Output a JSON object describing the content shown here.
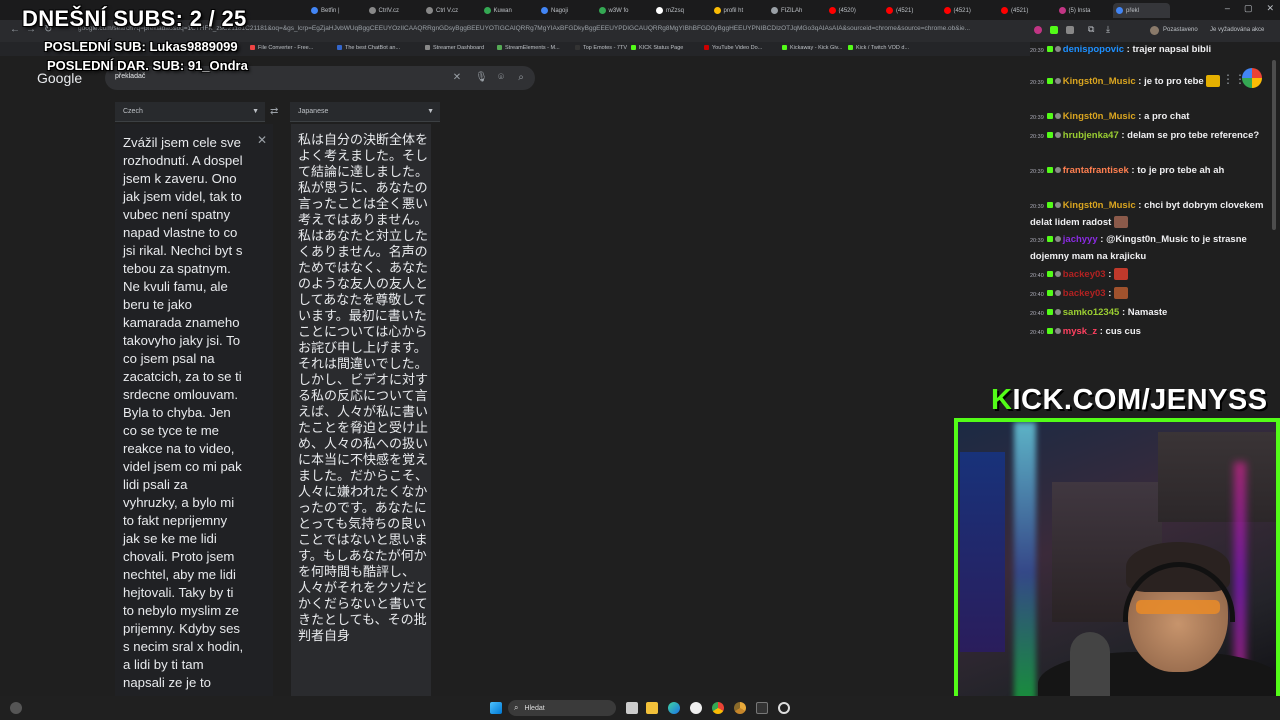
{
  "overlay": {
    "subs_count": "DNEŠNÍ SUBS: 2 / 25",
    "last_sub": "POSLEDNÍ SUB: Lukas9889099",
    "last_donation": "POSLEDNÍ DAR. SUB: 91_Ondra",
    "kick_banner_prefix": "K",
    "kick_banner_rest": "ICK.COM/JENYSS"
  },
  "browser": {
    "tabs": [
      {
        "label": "Betfin |",
        "color": "#4285f4"
      },
      {
        "label": "CtrlV.cz",
        "color": "#888888"
      },
      {
        "label": "Ctrl V.cz",
        "color": "#888888"
      },
      {
        "label": "Kuwan",
        "color": "#34a853"
      },
      {
        "label": "Nagoji",
        "color": "#4285f4"
      },
      {
        "label": "w3W fo",
        "color": "#34a853"
      },
      {
        "label": "mZzsq",
        "color": "#ffffff"
      },
      {
        "label": "profil ht",
        "color": "#fbbc05"
      },
      {
        "label": "FIZILAh",
        "color": "#9aa0a6"
      },
      {
        "label": "(4520) ",
        "color": "#ff0000"
      },
      {
        "label": "(4521) ",
        "color": "#ff0000"
      },
      {
        "label": "(4521) ",
        "color": "#ff0000"
      },
      {
        "label": "(4521) ",
        "color": "#ff0000"
      },
      {
        "label": "(5) Insta",
        "color": "#c13584"
      },
      {
        "label": "překl",
        "color": "#4285f4"
      }
    ],
    "url": "google.com/search?q=prekladac&oq=1CTHFK_zsC21181C21181&oq=&gs_lcrp=EgZjaHJvbWUqBggCEEUYOzIICAAQRRgnGDsyBggBEEUYOTIGCAIQRRg7MgYIAxBFGDkyBggEEEUYPDIGCAUQRRg8MgYIBhBFGD0yBggHEEUYPNIBCDIzOTJqMGo3qAIAsAIA&sourceid=chrome&source=chrome.ob&ie...",
    "profile_label": "Pozastaveno",
    "sync_label": "Je vyžadována akce",
    "bookmarks": [
      "File Converter - Free...",
      "The best ChatBot an...",
      "Streamer Dashboard",
      "StreamElements - M...",
      "Top Emotes - 7TV",
      "KICK Status Page",
      "YouTube Video Do...",
      "Kickaway - Kick Giv...",
      "Kick / Twitch VOD d..."
    ]
  },
  "google": {
    "logo": "Google",
    "query": "překladač",
    "clear_icon": "close-icon",
    "mic_icon": "mic-icon",
    "lens_icon": "lens-icon",
    "search_icon": "search-icon"
  },
  "translate": {
    "source_lang": "Czech",
    "target_lang": "Japanese",
    "source_text": "Zvážil jsem cele sve\nrozhodnutí. A dospel\njsem k zaveru. Ono\njak jsem videl, tak to\nvubec není spatny\nnapad vlastne to co\njsi rikal. Nechci byt s\ntebou za spatnym.\nNe kvuli famu, ale\nberu te jako\nkamarada znameho\ntakovyho jaky jsi. To\nco jsem psal na\nzacatcich, za to se ti\nsrdecne omlouvam.\nByla to chyba. Jen\nco se tyce te me\nreakce na to video,\nvidel jsem co mi pak\nlidi psali za\nvyhruzky, a bylo mi\nto fakt neprijemny\njak se ke me lidi\nchovali. Proto jsem\nnechtel, aby me lidi\nhejtovali. Taky by ti\nto nebylo myslim ze\nprijemny. Kdyby ses\ns necim sral x hodin,\na lidi by ti tam\nnapsali ze je to",
    "target_text": "私は自分の決断全体をよく考えました。そして結論に達しました。私が思うに、あなたの言ったことは全く悪い考えではありません。私はあなたと対立したくありません。名声のためではなく、あなたのような友人の友人としてあなたを尊敬しています。最初に書いたことについては心からお詫び申し上げます。それは間違いでした。しかし、ビデオに対する私の反応について言えば、人々が私に書いたことを脅迫と受け止め、人々の私への扱いに本当に不快感を覚えました。だからこそ、人々に嫌われたくなかったのです。あなたにとっても気持ちの良いことではないと思います。もしあなたが何かを何時間も酷評し、人々がそれをクソだとかくだらないと書いてきたとしても、その批判者自身"
  },
  "chat": {
    "messages": [
      {
        "time": "20:39",
        "user": "denispopovic",
        "user_color": "#1e90ff",
        "text": ": trajer napsal bibli",
        "emote": ""
      },
      {
        "time": "20:39",
        "user": "Kingst0n_Music",
        "user_color": "#daa520",
        "text": ": je to pro tebe",
        "emote": "#e5b000"
      },
      {
        "time": "20:39",
        "user": "Kingst0n_Music",
        "user_color": "#daa520",
        "text": ": a pro chat",
        "emote": ""
      },
      {
        "time": "20:39",
        "user": "hrubjenka47",
        "user_color": "#9acd32",
        "text": ": delam se pro tebe reference?",
        "emote": ""
      },
      {
        "time": "20:39",
        "user": "frantafrantisek",
        "user_color": "#ff7f50",
        "text": ": to je pro tebe ah ah",
        "emote": ""
      },
      {
        "time": "20:39",
        "user": "Kingst0n_Music",
        "user_color": "#daa520",
        "text": ": chci byt dobrym clovekem delat lidem radost",
        "emote": "#8b5a4a"
      },
      {
        "time": "20:39",
        "user": "jachyyy",
        "user_color": "#8a2be2",
        "text": ": @Kingst0n_Music to je strasne dojemny mam na krajicku",
        "emote": ""
      },
      {
        "time": "20:40",
        "user": "backey03",
        "user_color": "#b22222",
        "text": ":",
        "emote": "#c0392b"
      },
      {
        "time": "20:40",
        "user": "backey03",
        "user_color": "#b22222",
        "text": ":",
        "emote": "#a0522d"
      },
      {
        "time": "20:40",
        "user": "samko12345",
        "user_color": "#9acd32",
        "text": ": Namaste",
        "emote": ""
      },
      {
        "time": "20:40",
        "user": "mysk_z",
        "user_color": "#ff4060",
        "text": ": cus cus",
        "emote": ""
      }
    ]
  },
  "taskbar": {
    "search_placeholder": "Hledat",
    "icons": [
      "windows-icon",
      "task-view-icon",
      "file-explorer-icon",
      "edge-icon",
      "chrome-icon",
      "chrome-canary-icon",
      "store-icon",
      "terminal-icon",
      "obs-icon"
    ]
  },
  "colors": {
    "kick_green": "#53fc18",
    "background": "#1f1f1f"
  }
}
